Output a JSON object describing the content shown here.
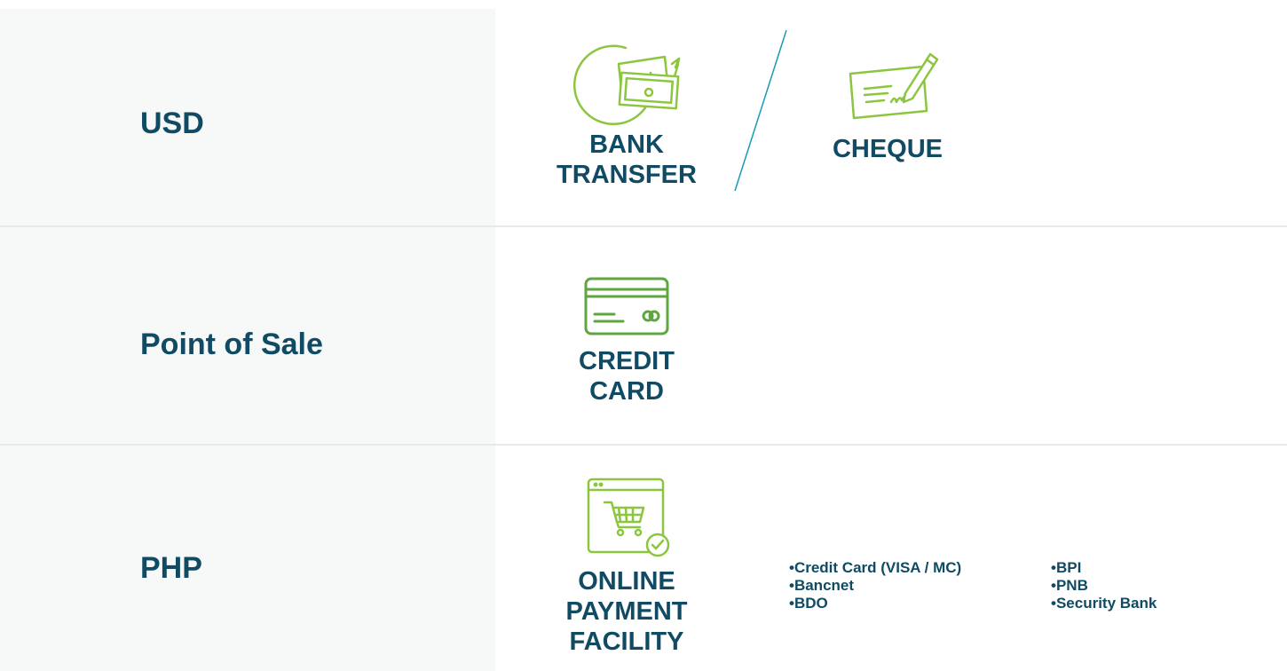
{
  "rows": [
    {
      "label": "USD",
      "methods": [
        {
          "label_lines": [
            "BANK",
            "TRANSFER"
          ],
          "icon": "bank-transfer-icon"
        },
        {
          "label_lines": [
            "CHEQUE"
          ],
          "icon": "cheque-icon"
        }
      ]
    },
    {
      "label": "Point of Sale",
      "methods": [
        {
          "label_lines": [
            "CREDIT",
            "CARD"
          ],
          "icon": "credit-card-icon"
        }
      ]
    },
    {
      "label": "PHP",
      "methods": [
        {
          "label_lines": [
            "ONLINE",
            "PAYMENT",
            "FACILITY"
          ],
          "icon": "online-shopping-cart-icon"
        }
      ],
      "options_left": [
        "Credit Card (VISA / MC)",
        "Bancnet",
        "BDO"
      ],
      "options_right": [
        "BPI",
        "PNB",
        "Security Bank"
      ]
    }
  ],
  "colors": {
    "heading": "#104a63",
    "icon_light_green": "#8cc63f",
    "icon_dark_green": "#5fa540",
    "label_background": "#f7f8f8",
    "divider": "#e7eaea",
    "slash": "#1a9bb5"
  }
}
